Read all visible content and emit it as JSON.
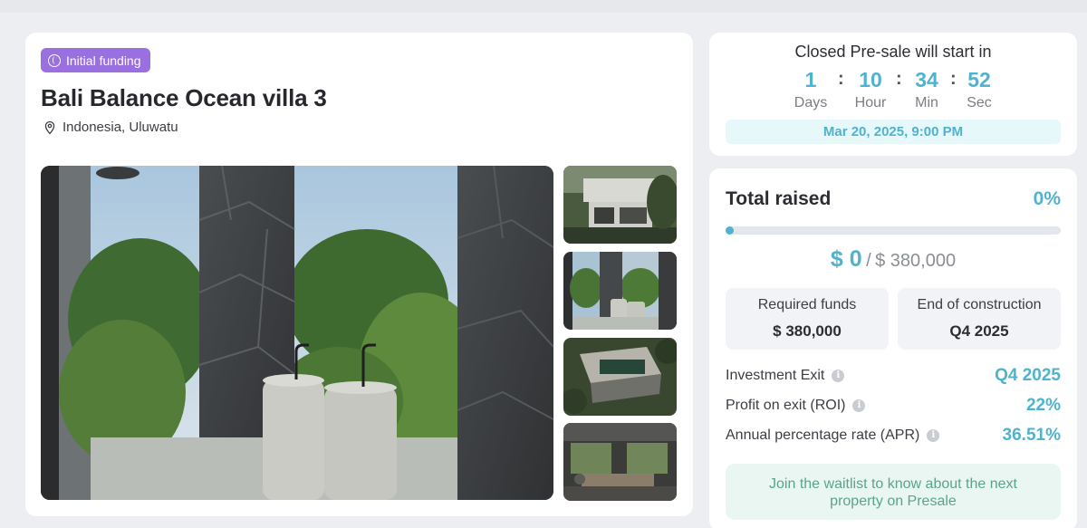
{
  "property": {
    "badge": "Initial funding",
    "title": "Bali Balance Ocean villa 3",
    "location": "Indonesia, Uluwatu"
  },
  "gallery": {
    "main_image": "bathroom-interior-photo",
    "thumbnails": [
      "villa-exterior-photo",
      "bathroom-photo",
      "aerial-villa-photo",
      "living-room-photo"
    ]
  },
  "timer": {
    "title": "Closed Pre-sale will start in",
    "units": [
      {
        "value": "1",
        "label": "Days"
      },
      {
        "value": "10",
        "label": "Hour"
      },
      {
        "value": "34",
        "label": "Min"
      },
      {
        "value": "52",
        "label": "Sec"
      }
    ],
    "separator": ":",
    "date": "Mar 20, 2025, 9:00 PM"
  },
  "funding": {
    "heading": "Total raised",
    "percent": "0%",
    "progress_fraction": 0,
    "raised": "$ 0",
    "separator": "/",
    "goal": "$ 380,000",
    "required_label": "Required funds",
    "required_value": "$ 380,000",
    "construction_label": "End of construction",
    "construction_value": "Q4 2025",
    "stats": [
      {
        "label": "Investment Exit",
        "value": "Q4 2025"
      },
      {
        "label": "Profit on exit (ROI)",
        "value": "22%"
      },
      {
        "label": "Annual percentage rate (APR)",
        "value": "36.51%"
      }
    ],
    "waitlist_text": "Join the waitlist to know about the next property on Presale"
  },
  "colors": {
    "accent": "#4fb3cf",
    "badge": "#9a6fe0",
    "waitlist_text": "#5aa58a"
  }
}
